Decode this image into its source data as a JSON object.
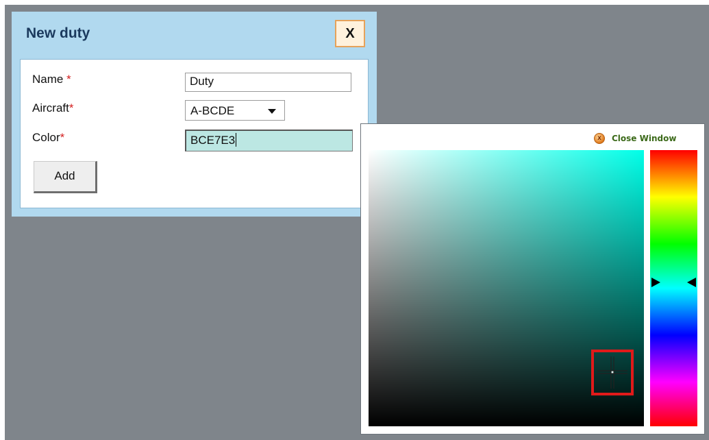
{
  "dialog": {
    "title": "New duty",
    "close_label": "X",
    "fields": {
      "name": {
        "label": "Name",
        "required_mark": "*",
        "value": "Duty"
      },
      "aircraft": {
        "label": "Aircraft",
        "required_mark": "*",
        "value": "A-BCDE"
      },
      "color": {
        "label": "Color",
        "required_mark": "*",
        "value": "BCE7E3"
      }
    },
    "add_label": "Add"
  },
  "color_picker": {
    "close_label": "Close Window",
    "close_icon": "close-circle-icon",
    "selected_color": "#BCE7E3",
    "hue_level": 0.49
  },
  "colors": {
    "backdrop": "#7f858b",
    "dialog_header": "#b1d9ef",
    "required_mark": "#d42020",
    "color_input_bg": "#BCE7E3",
    "selection_box": "#e01a1a",
    "close_link_text": "#3c6a1a"
  }
}
